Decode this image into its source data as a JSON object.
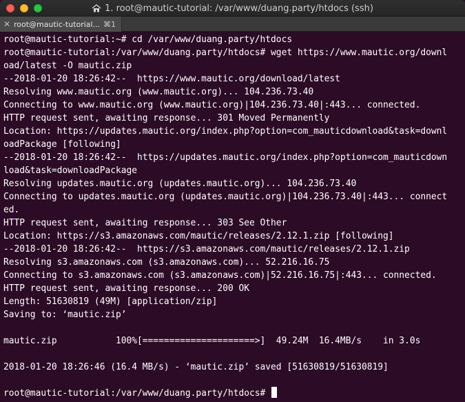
{
  "window": {
    "title": "1. root@mautic-tutorial: /var/www/duang.party/htdocs (ssh)",
    "tab": {
      "close_symbol": "✕",
      "label": "root@mautic-tutorial...",
      "shortcut": "⌘1"
    }
  },
  "colors": {
    "terminal_background": "#2c0b26",
    "terminal_text": "#ffffff"
  },
  "terminal": {
    "lines": [
      "root@mautic-tutorial:~# cd /var/www/duang.party/htdocs",
      "root@mautic-tutorial:/var/www/duang.party/htdocs# wget https://www.mautic.org/downl",
      "oad/latest -O mautic.zip",
      "--2018-01-20 18:26:42--  https://www.mautic.org/download/latest",
      "Resolving www.mautic.org (www.mautic.org)... 104.236.73.40",
      "Connecting to www.mautic.org (www.mautic.org)|104.236.73.40|:443... connected.",
      "HTTP request sent, awaiting response... 301 Moved Permanently",
      "Location: https://updates.mautic.org/index.php?option=com_mauticdownload&task=downl",
      "oadPackage [following]",
      "--2018-01-20 18:26:42--  https://updates.mautic.org/index.php?option=com_mauticdown",
      "load&task=downloadPackage",
      "Resolving updates.mautic.org (updates.mautic.org)... 104.236.73.40",
      "Connecting to updates.mautic.org (updates.mautic.org)|104.236.73.40|:443... connect",
      "ed.",
      "HTTP request sent, awaiting response... 303 See Other",
      "Location: https://s3.amazonaws.com/mautic/releases/2.12.1.zip [following]",
      "--2018-01-20 18:26:42--  https://s3.amazonaws.com/mautic/releases/2.12.1.zip",
      "Resolving s3.amazonaws.com (s3.amazonaws.com)... 52.216.16.75",
      "Connecting to s3.amazonaws.com (s3.amazonaws.com)|52.216.16.75|:443... connected.",
      "HTTP request sent, awaiting response... 200 OK",
      "Length: 51630819 (49M) [application/zip]",
      "Saving to: ‘mautic.zip’",
      "",
      "mautic.zip           100%[=====================>]  49.24M  16.4MB/s    in 3.0s",
      "",
      "2018-01-20 18:26:46 (16.4 MB/s) - ‘mautic.zip’ saved [51630819/51630819]",
      "",
      "root@mautic-tutorial:/var/www/duang.party/htdocs# "
    ]
  }
}
